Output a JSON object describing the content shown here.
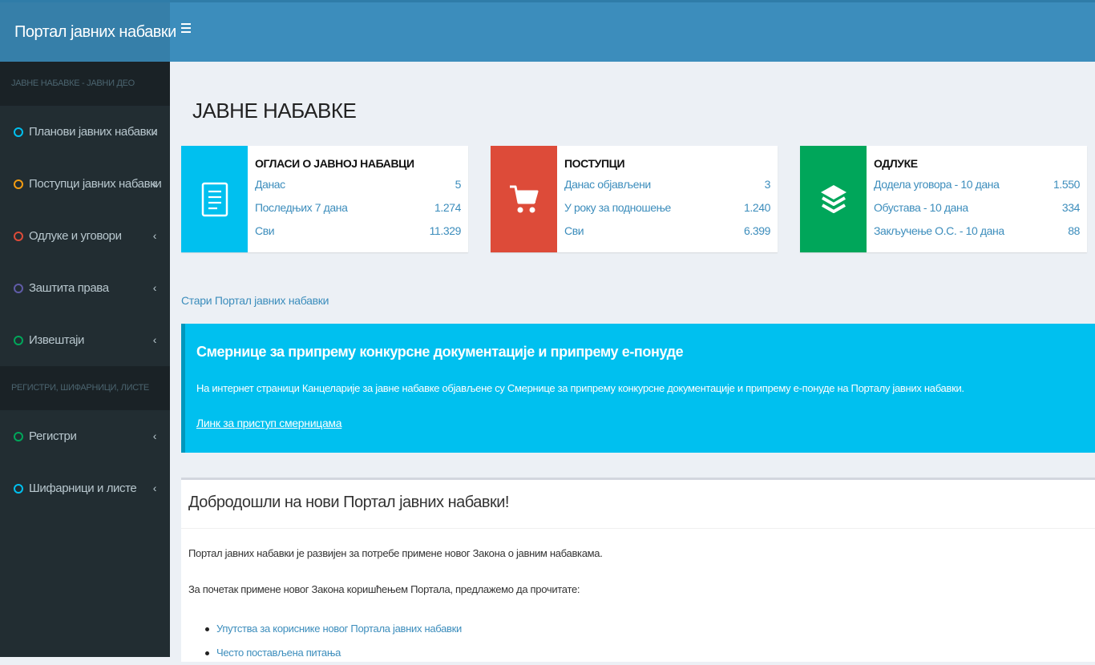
{
  "app": {
    "title": "Портал јавних набавки"
  },
  "colors": {
    "header": "#3c8dbc",
    "sidebar": "#222d32",
    "aqua": "#00c0ef",
    "red": "#dd4b39",
    "green": "#00a65a"
  },
  "sidebar": {
    "section1": "ЈАВНЕ НАБАВКЕ - ЈАВНИ ДЕО",
    "items1": [
      {
        "label": "Планови јавних набавки",
        "ring": "#00c0ef"
      },
      {
        "label": "Поступци јавних набавки",
        "ring": "#f39c12"
      },
      {
        "label": "Одлуке и уговори",
        "ring": "#dd4b39"
      },
      {
        "label": "Заштита права",
        "ring": "#605ca8"
      },
      {
        "label": "Извештаји",
        "ring": "#00a65a"
      }
    ],
    "section2": "РЕГИСТРИ, ШИФАРНИЦИ, ЛИСТЕ",
    "items2": [
      {
        "label": "Регистри",
        "ring": "#00a65a"
      },
      {
        "label": "Шифарници и листе",
        "ring": "#00c0ef"
      }
    ],
    "chevron": "‹"
  },
  "main": {
    "page_title": "ЈАВНЕ НАБАВКЕ",
    "boxes": [
      {
        "title": "ОГЛАСИ О ЈАВНОЈ НАБАВЦИ",
        "icon": "document-icon",
        "rows": [
          {
            "label": "Данас",
            "value": "5"
          },
          {
            "label": "Последњих 7 дана",
            "value": "1.274"
          },
          {
            "label": "Сви",
            "value": "11.329"
          }
        ]
      },
      {
        "title": "ПОСТУПЦИ",
        "icon": "cart-icon",
        "rows": [
          {
            "label": "Данас објављени",
            "value": "3"
          },
          {
            "label": "У року за подношење",
            "value": "1.240"
          },
          {
            "label": "Сви",
            "value": "6.399"
          }
        ]
      },
      {
        "title": "ОДЛУКЕ",
        "icon": "layers-icon",
        "rows": [
          {
            "label": "Додела уговора - 10 дана",
            "value": "1.550"
          },
          {
            "label": "Обустава - 10 дана",
            "value": "334"
          },
          {
            "label": "Закључење О.С. - 10 дана",
            "value": "88"
          }
        ]
      }
    ],
    "old_portal_link": "Стари Портал јавних набавки",
    "callout": {
      "title": "Смернице за припрему конкурсне документације и припрему е-понуде",
      "text": "На интернет страници Канцеларије за јавне набавке објављене су Смернице за припрему конкурсне документације и припрему е-понуде на Порталу јавних набавки.",
      "link": "Линк за приступ смерницама"
    },
    "welcome": {
      "title": "Добродошли на нови Портал јавних набавки!",
      "p1": "Портал јавних набавки је развијен за потребе примене новог Закона о јавним набавкама.",
      "p2": "За почетак примене новог Закона коришћењем Портала, предлажемо да прочитате:",
      "links": [
        "Упутства за кориснике новог Портала јавних набавки",
        "Често постављена питања"
      ]
    }
  }
}
